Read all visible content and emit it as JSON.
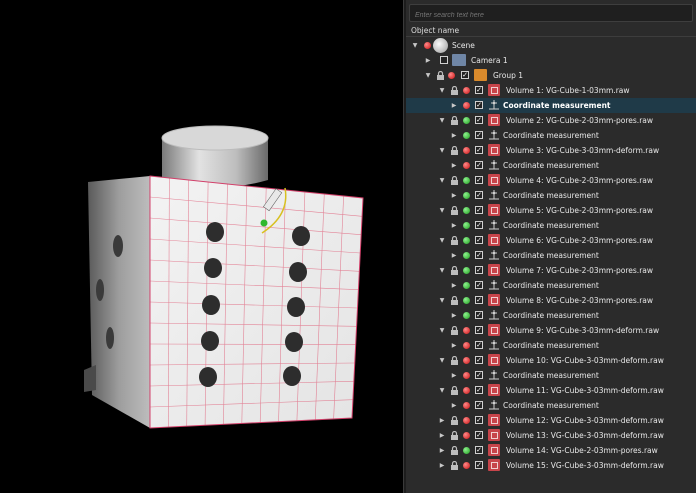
{
  "search": {
    "placeholder": "Enter search text here"
  },
  "tree_header": {
    "column": "Object name"
  },
  "scene": {
    "label": "Scene"
  },
  "camera": {
    "label": "Camera 1"
  },
  "group": {
    "label": "Group 1"
  },
  "measurement_label": "Coordinate measurement",
  "volumes": [
    {
      "label": "Volume 1: VG-Cube-1-03mm.raw",
      "status": "red",
      "child_status": "red",
      "child_selected": true
    },
    {
      "label": "Volume 2: VG-Cube-2-03mm-pores.raw",
      "status": "green",
      "child_status": "green"
    },
    {
      "label": "Volume 3: VG-Cube-3-03mm-deform.raw",
      "status": "red",
      "child_status": "red"
    },
    {
      "label": "Volume 4: VG-Cube-2-03mm-pores.raw",
      "status": "green",
      "child_status": "green"
    },
    {
      "label": "Volume 5: VG-Cube-2-03mm-pores.raw",
      "status": "green",
      "child_status": "green"
    },
    {
      "label": "Volume 6: VG-Cube-2-03mm-pores.raw",
      "status": "green",
      "child_status": "green"
    },
    {
      "label": "Volume 7: VG-Cube-2-03mm-pores.raw",
      "status": "green",
      "child_status": "green"
    },
    {
      "label": "Volume 8: VG-Cube-2-03mm-pores.raw",
      "status": "green",
      "child_status": "green"
    },
    {
      "label": "Volume 9: VG-Cube-3-03mm-deform.raw",
      "status": "red",
      "child_status": "red"
    },
    {
      "label": "Volume 10: VG-Cube-3-03mm-deform.raw",
      "status": "red",
      "child_status": "red"
    },
    {
      "label": "Volume 11: VG-Cube-3-03mm-deform.raw",
      "status": "red",
      "child_status": "red"
    },
    {
      "label": "Volume 12: VG-Cube-3-03mm-deform.raw",
      "status": "red",
      "collapsed": true
    },
    {
      "label": "Volume 13: VG-Cube-3-03mm-deform.raw",
      "status": "red",
      "collapsed": true
    },
    {
      "label": "Volume 14: VG-Cube-2-03mm-pores.raw",
      "status": "green",
      "collapsed": true
    },
    {
      "label": "Volume 15: VG-Cube-3-03mm-deform.raw",
      "status": "red",
      "collapsed": true
    }
  ],
  "colors": {
    "panel_bg": "#2b2b2b",
    "selection": "#1f3a48",
    "status_red": "#c80f0f",
    "status_green": "#1ea01e",
    "volume_icon": "#c7444a"
  }
}
